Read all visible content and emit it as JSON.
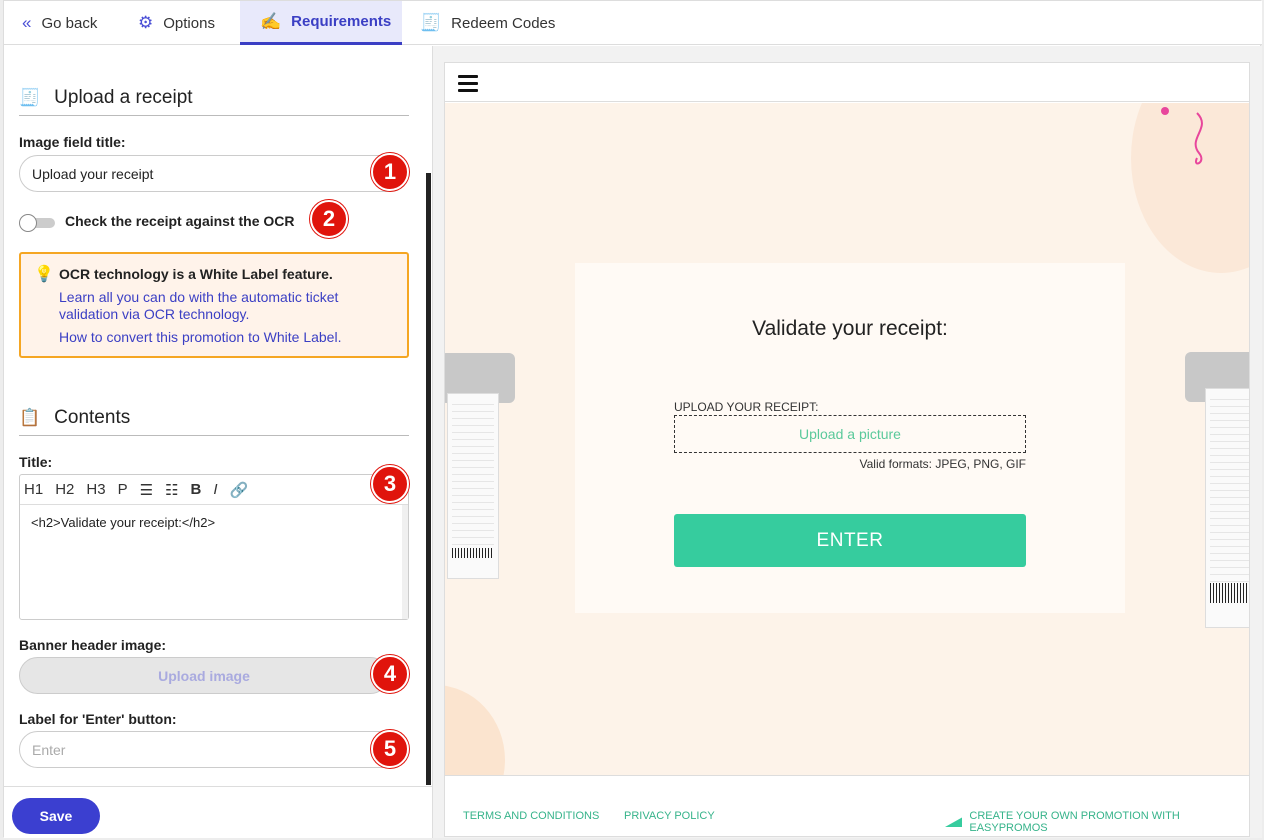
{
  "tabs": [
    {
      "label": "Go back",
      "icon": "double-chevron-left-icon"
    },
    {
      "label": "Options",
      "icon": "gear-icon"
    },
    {
      "label": "Requirements",
      "icon": "pen-signature-icon"
    },
    {
      "label": "Redeem Codes",
      "icon": "receipt-icon"
    }
  ],
  "upload_section": {
    "title": "Upload a receipt",
    "image_field_title_label": "Image field title:",
    "image_field_title_value": "Upload your receipt",
    "ocr_toggle_label": "Check the receipt against the OCR",
    "ocr_toggle_on": false,
    "alert_title": "OCR technology is a White Label feature.",
    "alert_link1": "Learn all you can do with the automatic ticket validation via OCR technology.",
    "alert_link2": "How to convert this promotion to White Label."
  },
  "contents_section": {
    "title": "Contents",
    "title_label": "Title:",
    "toolbar": [
      "H1",
      "H2",
      "H3",
      "P",
      "☰",
      "☷",
      "B",
      "I",
      "🔗"
    ],
    "editor_value": "<h2>Validate your  receipt:</h2>",
    "banner_label": "Banner header image:",
    "upload_image_label": "Upload image",
    "enter_label_label": "Label for 'Enter' button:",
    "enter_placeholder": "Enter"
  },
  "badges": [
    "1",
    "2",
    "3",
    "4",
    "5"
  ],
  "save_label": "Save",
  "preview": {
    "heading": "Validate your receipt:",
    "upload_label": "UPLOAD YOUR RECEIPT:",
    "upload_picture": "Upload a picture",
    "valid_formats": "Valid formats: JPEG, PNG, GIF",
    "enter_button": "ENTER",
    "footer_terms": "TERMS AND CONDITIONS",
    "footer_privacy": "PRIVACY POLICY",
    "footer_create": "CREATE YOUR OWN PROMOTION WITH EASYPROMOS"
  },
  "colors": {
    "accent": "#3b3fd0",
    "badge": "#e0140c",
    "enter": "#36cc9e",
    "alert_border": "#f5a623"
  }
}
